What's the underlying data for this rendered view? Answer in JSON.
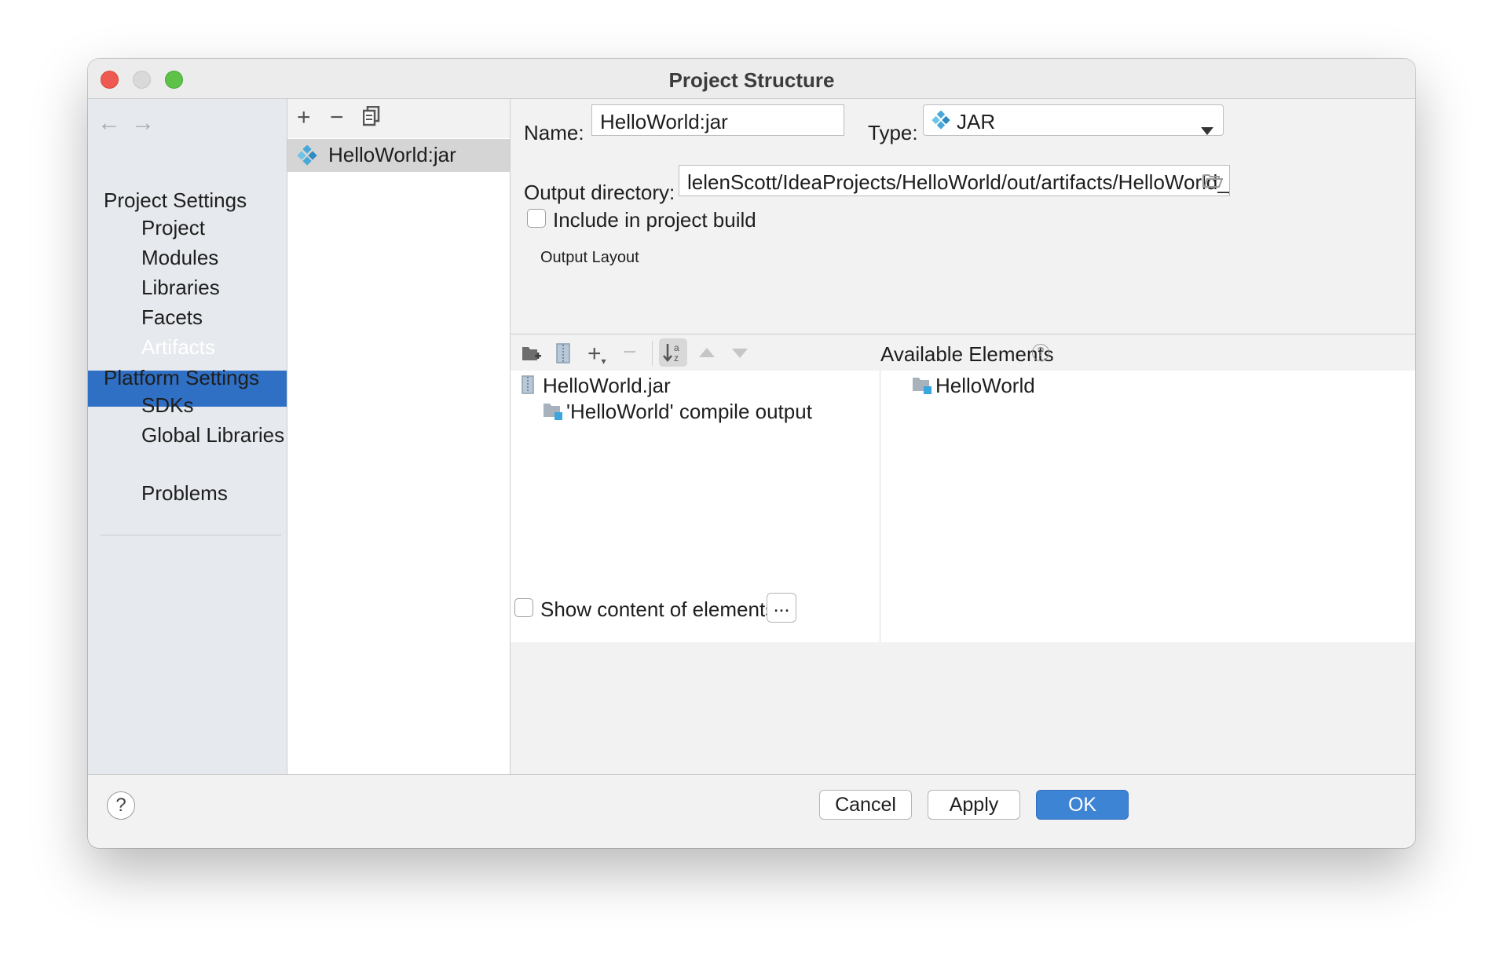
{
  "window": {
    "title": "Project Structure"
  },
  "sidebar": {
    "back_icon": "arrow-left-icon",
    "forward_icon": "arrow-right-icon",
    "project_settings_header": "Project Settings",
    "project_items": [
      "Project",
      "Modules",
      "Libraries",
      "Facets",
      "Artifacts"
    ],
    "platform_settings_header": "Platform Settings",
    "platform_items": [
      "SDKs",
      "Global Libraries"
    ],
    "problems": "Problems",
    "selected": "Artifacts"
  },
  "artifacts_list": {
    "toolbar": {
      "add": "+",
      "remove": "−",
      "copy_icon": "copy-icon"
    },
    "items": [
      "HelloWorld:jar"
    ]
  },
  "editor": {
    "name_label": "Name:",
    "name_value": "HelloWorld:jar",
    "type_label": "Type:",
    "type_value": "JAR",
    "output_dir_label": "Output directory:",
    "output_dir_value": "lelenScott/IdeaProjects/HelloWorld/out/artifacts/HelloWorld_jar",
    "include_label": "Include in project build",
    "include_checked": false,
    "output_layout_label": "Output Layout",
    "available_label": "Available Elements",
    "layout_tree": [
      {
        "label": "HelloWorld.jar",
        "icon": "jar-archive-icon"
      },
      {
        "label": "'HelloWorld' compile output",
        "icon": "module-folder-icon"
      }
    ],
    "available_tree": [
      {
        "label": "HelloWorld",
        "icon": "module-folder-icon"
      }
    ],
    "show_content_label": "Show content of elements",
    "show_content_checked": false,
    "ellipsis_button": "..."
  },
  "footer": {
    "help": "?",
    "cancel": "Cancel",
    "apply": "Apply",
    "ok": "OK"
  },
  "colors": {
    "selection": "#2f6fc4",
    "ok_button": "#3d84d4",
    "close": "#ee5a51",
    "maximize": "#5ec248"
  }
}
